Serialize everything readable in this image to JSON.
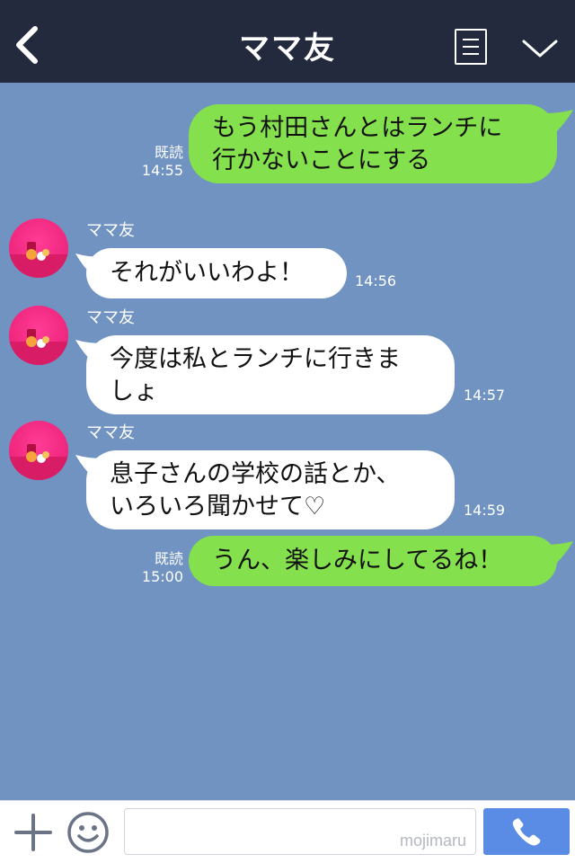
{
  "header": {
    "title": "ママ友",
    "back_icon": "back-chevron-icon",
    "menu_icon": "list-menu-icon",
    "collapse_icon": "chevron-down-icon"
  },
  "colors": {
    "header_bg": "#232a3d",
    "chat_bg": "#7193c1",
    "outgoing_bubble": "#84e04c",
    "incoming_bubble": "#ffffff",
    "call_button": "#5a8ce6"
  },
  "messages": [
    {
      "direction": "out",
      "lines": [
        "もう村田さんとはランチに",
        "行かないことにする"
      ],
      "read": "既読",
      "time": "14:55"
    },
    {
      "direction": "in",
      "sender": "ママ友",
      "lines": [
        "それがいいわよ！"
      ],
      "time": "14:56"
    },
    {
      "direction": "in",
      "sender": "ママ友",
      "lines": [
        "今度は私とランチに行きま",
        "しょ"
      ],
      "time": "14:57"
    },
    {
      "direction": "in",
      "sender": "ママ友",
      "lines": [
        "息子さんの学校の話とか、",
        "いろいろ聞かせて♡"
      ],
      "time": "14:59"
    },
    {
      "direction": "out",
      "lines": [
        "うん、楽しみにしてるね！"
      ],
      "read": "既読",
      "time": "15:00"
    }
  ],
  "footer": {
    "plus_icon": "plus-icon",
    "emoji_icon": "smiley-icon",
    "input_value": "",
    "watermark": "mojimaru",
    "call_icon": "phone-icon"
  }
}
